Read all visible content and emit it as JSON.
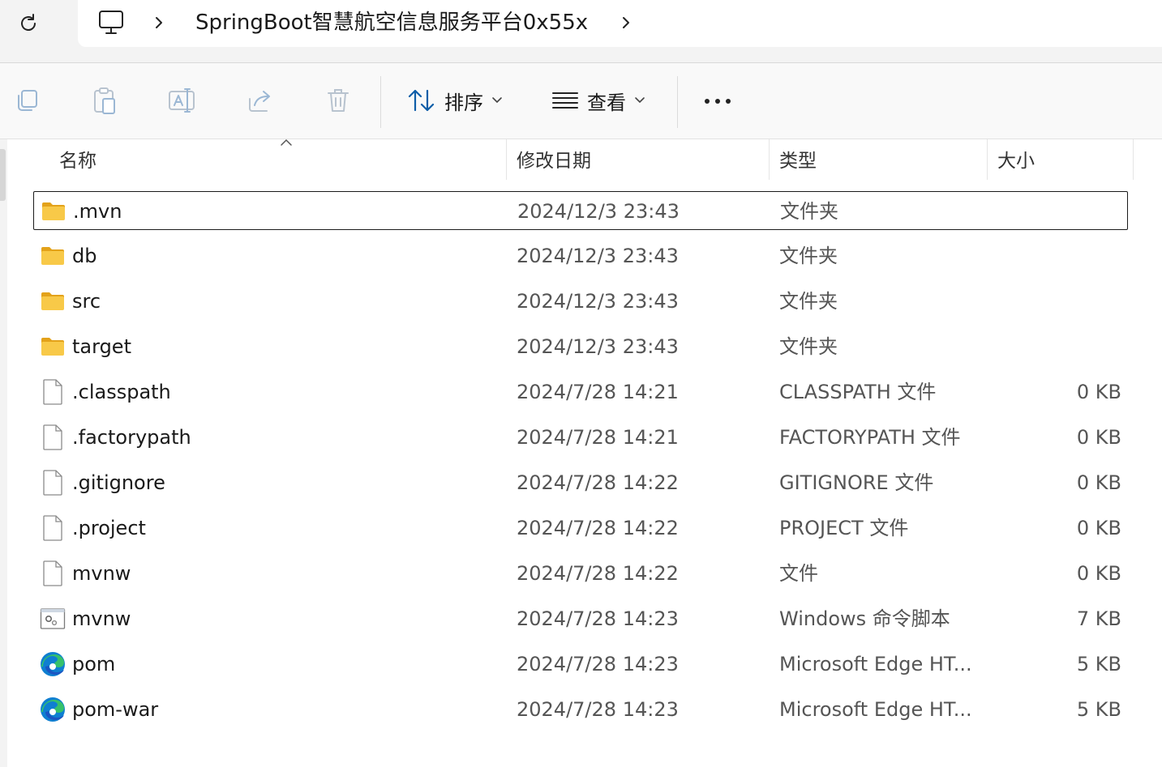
{
  "address_bar": {
    "path": "SpringBoot智慧航空信息服务平台0x55x"
  },
  "toolbar": {
    "sort_label": "排序",
    "view_label": "查看"
  },
  "columns": {
    "name": "名称",
    "date": "修改日期",
    "type": "类型",
    "size": "大小"
  },
  "files": [
    {
      "icon": "folder-icon",
      "name": ".mvn",
      "date": "2024/12/3 23:43",
      "type": "文件夹",
      "size": "",
      "selected": true
    },
    {
      "icon": "folder-icon",
      "name": "db",
      "date": "2024/12/3 23:43",
      "type": "文件夹",
      "size": ""
    },
    {
      "icon": "folder-icon",
      "name": "src",
      "date": "2024/12/3 23:43",
      "type": "文件夹",
      "size": ""
    },
    {
      "icon": "folder-icon",
      "name": "target",
      "date": "2024/12/3 23:43",
      "type": "文件夹",
      "size": ""
    },
    {
      "icon": "file-icon",
      "name": ".classpath",
      "date": "2024/7/28 14:21",
      "type": "CLASSPATH 文件",
      "size": "0 KB"
    },
    {
      "icon": "file-icon",
      "name": ".factorypath",
      "date": "2024/7/28 14:21",
      "type": "FACTORYPATH 文件",
      "size": "0 KB"
    },
    {
      "icon": "file-icon",
      "name": ".gitignore",
      "date": "2024/7/28 14:22",
      "type": "GITIGNORE 文件",
      "size": "0 KB"
    },
    {
      "icon": "file-icon",
      "name": ".project",
      "date": "2024/7/28 14:22",
      "type": "PROJECT 文件",
      "size": "0 KB"
    },
    {
      "icon": "file-icon",
      "name": "mvnw",
      "date": "2024/7/28 14:22",
      "type": "文件",
      "size": "0 KB"
    },
    {
      "icon": "script-icon",
      "name": "mvnw",
      "date": "2024/7/28 14:23",
      "type": "Windows 命令脚本",
      "size": "7 KB"
    },
    {
      "icon": "edge-icon",
      "name": "pom",
      "date": "2024/7/28 14:23",
      "type": "Microsoft Edge HT...",
      "size": "5 KB"
    },
    {
      "icon": "edge-icon",
      "name": "pom-war",
      "date": "2024/7/28 14:23",
      "type": "Microsoft Edge HT...",
      "size": "5 KB"
    }
  ],
  "colors": {
    "folder": "#f8c948",
    "edge_blue": "#0f7fd1",
    "edge_green": "#36c16b",
    "selection_border": "#1a1a1a"
  }
}
